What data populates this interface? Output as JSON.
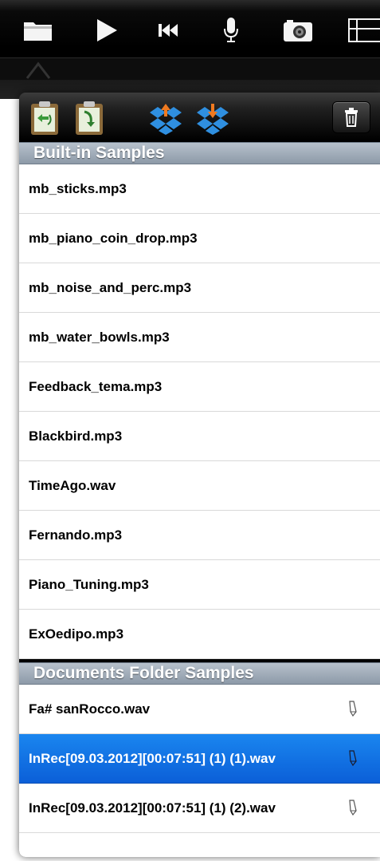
{
  "toolbar": {
    "icons": [
      "folder-icon",
      "play-icon",
      "rewind-icon",
      "microphone-icon",
      "camera-icon",
      "grid-icon"
    ]
  },
  "panel": {
    "toolbar_icons": [
      "clipboard-import-icon",
      "clipboard-export-icon",
      "dropbox-upload-icon",
      "dropbox-download-icon",
      "trash-icon"
    ]
  },
  "builtin": {
    "header": "Built-in Samples",
    "items": [
      "mb_sticks.mp3",
      "mb_piano_coin_drop.mp3",
      "mb_noise_and_perc.mp3",
      "mb_water_bowls.mp3",
      "Feedback_tema.mp3",
      "Blackbird.mp3",
      "TimeAgo.wav",
      "Fernando.mp3",
      "Piano_Tuning.mp3",
      "ExOedipo.mp3"
    ]
  },
  "documents": {
    "header": "Documents Folder Samples",
    "items": [
      "Fa# sanRocco.wav",
      "InRec[09.03.2012][00:07:51] (1) (1).wav",
      "InRec[09.03.2012][00:07:51] (1) (2).wav"
    ],
    "selected_index": 1
  },
  "colors": {
    "selection": "#0b5fd8",
    "section_header": "#9aa6b3"
  }
}
